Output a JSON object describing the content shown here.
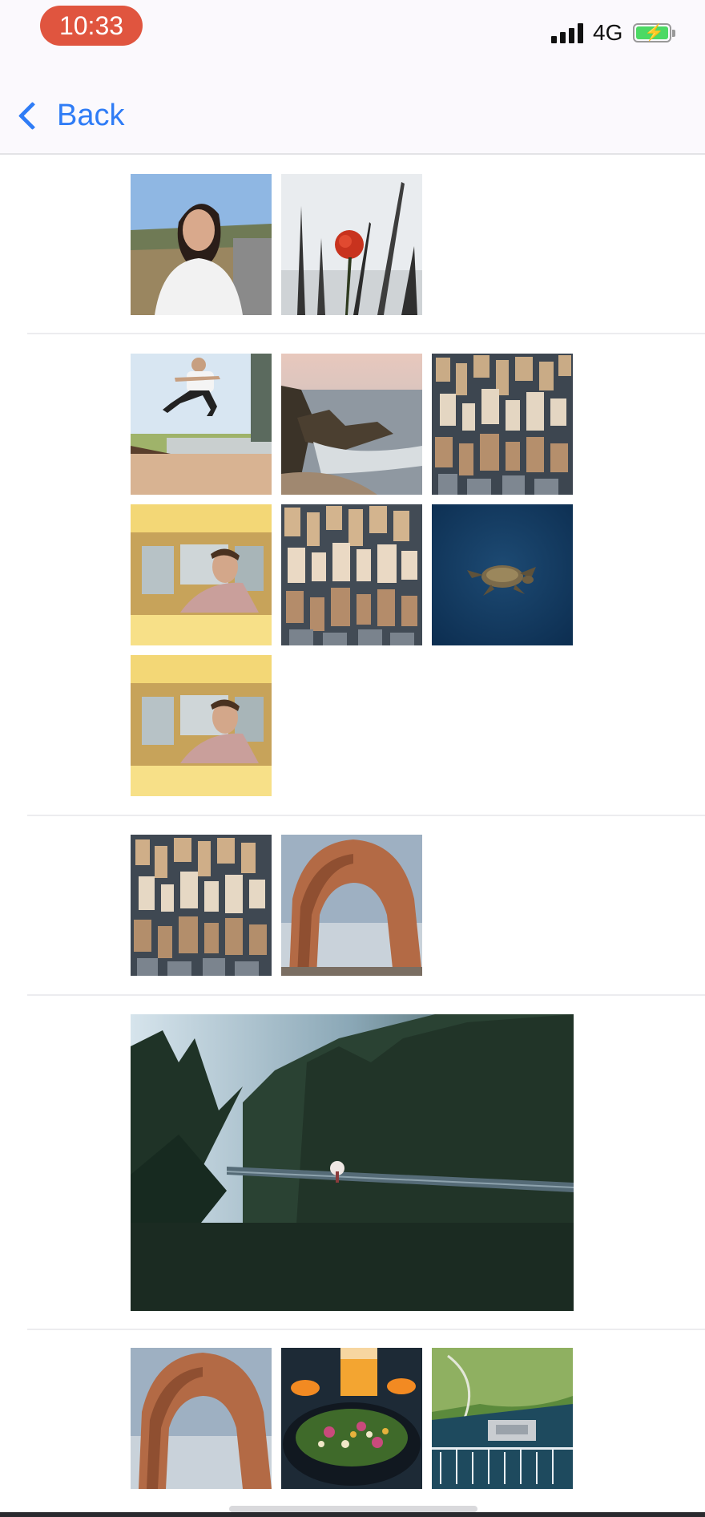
{
  "status_bar": {
    "time": "10:33",
    "network": "4G",
    "signal_icon": "cellular-signal-icon",
    "battery_icon": "battery-charging-icon"
  },
  "nav": {
    "back_label": "Back",
    "back_icon": "chevron-left-icon",
    "accent": "#2f7cf6"
  },
  "sections": [
    {
      "items": [
        "photo-woman-portrait",
        "photo-red-poppy"
      ]
    },
    {
      "items": [
        "photo-skateboarder",
        "photo-coastal-cove",
        "photo-city-aerial",
        "photo-man-in-car",
        "photo-city-aerial",
        "photo-sea-turtle",
        "photo-man-in-car"
      ]
    },
    {
      "items": [
        "photo-city-aerial",
        "photo-rock-arch"
      ]
    },
    {
      "items": [
        "photo-forest-bridge"
      ]
    },
    {
      "items": [
        "photo-rock-arch",
        "photo-salad-bowl",
        "photo-marina-aerial"
      ]
    }
  ]
}
